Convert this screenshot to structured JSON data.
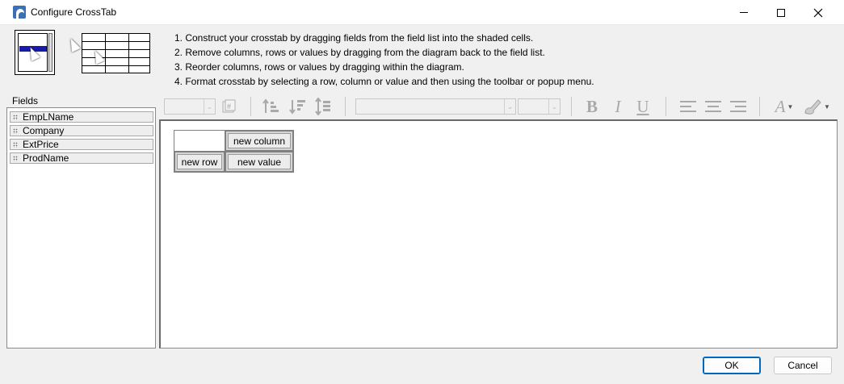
{
  "window": {
    "title": "Configure CrossTab",
    "icon": "app-icon"
  },
  "instructions": [
    "1. Construct your crosstab by dragging fields from the field list into the shaded cells.",
    "2. Remove columns, rows or values by dragging from the diagram back to the field list.",
    "3. Reorder columns, rows or values by dragging within the diagram.",
    "4. Format crosstab by selecting a row, column or value and then using the toolbar or popup menu."
  ],
  "fields": {
    "label": "Fields",
    "items": [
      "EmpLName",
      "Company",
      "ExtPrice",
      "ProdName"
    ]
  },
  "toolbar": {
    "bold": "B",
    "italic": "I",
    "underline": "U",
    "font_color": "A",
    "hash": "#",
    "dropdown_arrow": "⌄"
  },
  "crosstab": {
    "column": "new column",
    "row": "new row",
    "value": "new value"
  },
  "buttons": {
    "ok": "OK",
    "cancel": "Cancel"
  },
  "colors": {
    "ok_border": "#0067c0",
    "cell_fill": "#ececec"
  }
}
